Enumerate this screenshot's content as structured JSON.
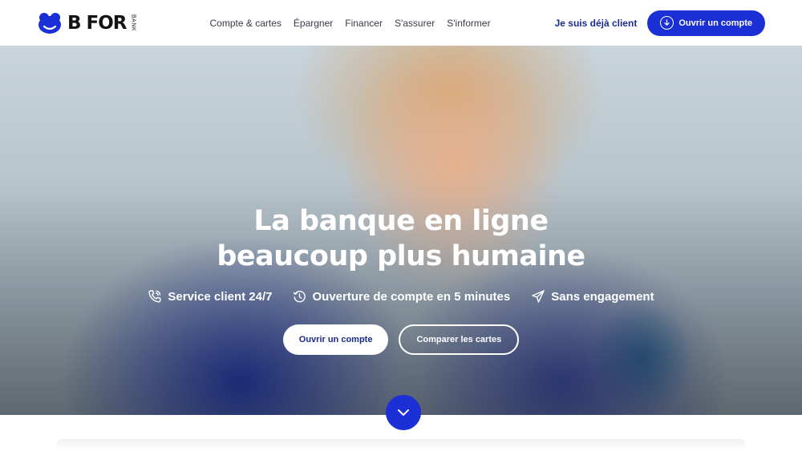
{
  "brand": {
    "name": "B FOR",
    "sub": "BANK"
  },
  "nav": {
    "items": [
      "Compte & cartes",
      "Épargner",
      "Financer",
      "S'assurer",
      "S'informer"
    ]
  },
  "header": {
    "client_link": "Je suis déjà client",
    "open_account": "Ouvrir un compte"
  },
  "hero": {
    "title_line1": "La banque en ligne",
    "title_line2": "beaucoup plus humaine",
    "features": [
      {
        "icon": "phone-icon",
        "label": "Service client 24/7"
      },
      {
        "icon": "clock-icon",
        "label": "Ouverture de compte en 5 minutes"
      },
      {
        "icon": "paper-plane-icon",
        "label": "Sans engagement"
      }
    ],
    "primary_cta": "Ouvrir un compte",
    "secondary_cta": "Comparer les cartes"
  },
  "colors": {
    "accent": "#1a2fd6",
    "nav_link": "#1a2b8f"
  }
}
